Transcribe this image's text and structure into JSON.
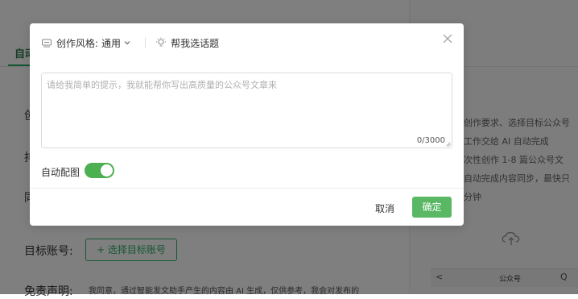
{
  "background": {
    "tab_auto": "自动",
    "side_chars": [
      "创",
      "排",
      "同"
    ],
    "tips": [
      "创作要求、选择目标公众号",
      "工作交给 AI 自动完成",
      "次性创作 1-8 篇公众号文",
      "自动完成内容同步，最快只",
      "分钟"
    ],
    "target_label": "目标账号:",
    "target_button": "+ 选择目标账号",
    "disclaimer_label": "免责声明:",
    "disclaimer_text": "我同意，通过智能发文助手产生的内容由 AI 生成，仅供参考，我会对发布的",
    "phone_title": "公众号",
    "phone_back": "<",
    "phone_search": "Q"
  },
  "modal": {
    "style_label": "创作风格:",
    "style_value": "通用",
    "topic_button": "帮我选话题",
    "textarea_placeholder": "请给我简单的提示，我就能帮你写出高质量的公众号文章来",
    "counter": "0/3000",
    "auto_image_label": "自动配图",
    "auto_image_enabled": true,
    "cancel_label": "取消",
    "ok_label": "确定"
  },
  "colors": {
    "accent": "#2aae67",
    "toggle": "#4caf50",
    "ok_button": "#5ab865",
    "overlay": "rgba(0,0,0,0.5)"
  }
}
